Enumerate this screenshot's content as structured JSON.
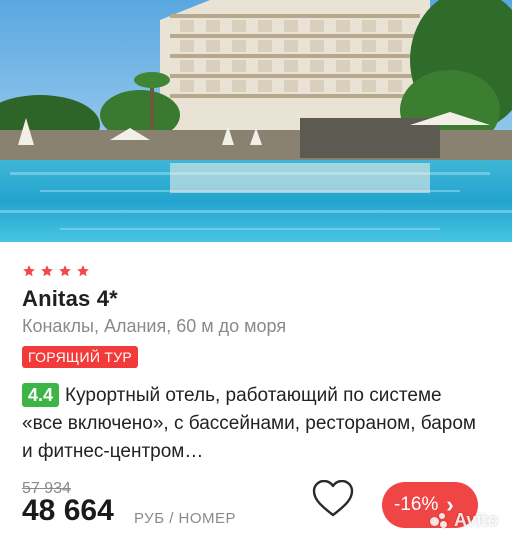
{
  "card": {
    "stars": 4,
    "star_color": "#f24848",
    "title": "Anitas 4*",
    "location": "Конаклы, Алания, 60 м до моря",
    "hot_badge": "ГОРЯЩИЙ ТУР",
    "rating": "4.4",
    "rating_color": "#3cb544",
    "description": "Курортный отель, работающий по системе «все включено», с бассейнами, рестораном, баром и фитнес-центром…",
    "old_price": "57 934",
    "price": "48 664",
    "price_unit": "РУБ / НОМЕР",
    "discount": "-16%",
    "discount_color": "#f04545"
  },
  "watermark": {
    "text": "Avito"
  },
  "icons": {
    "favorite": "heart-icon",
    "next": "chevron-right-icon",
    "rating_star": "star-icon"
  }
}
